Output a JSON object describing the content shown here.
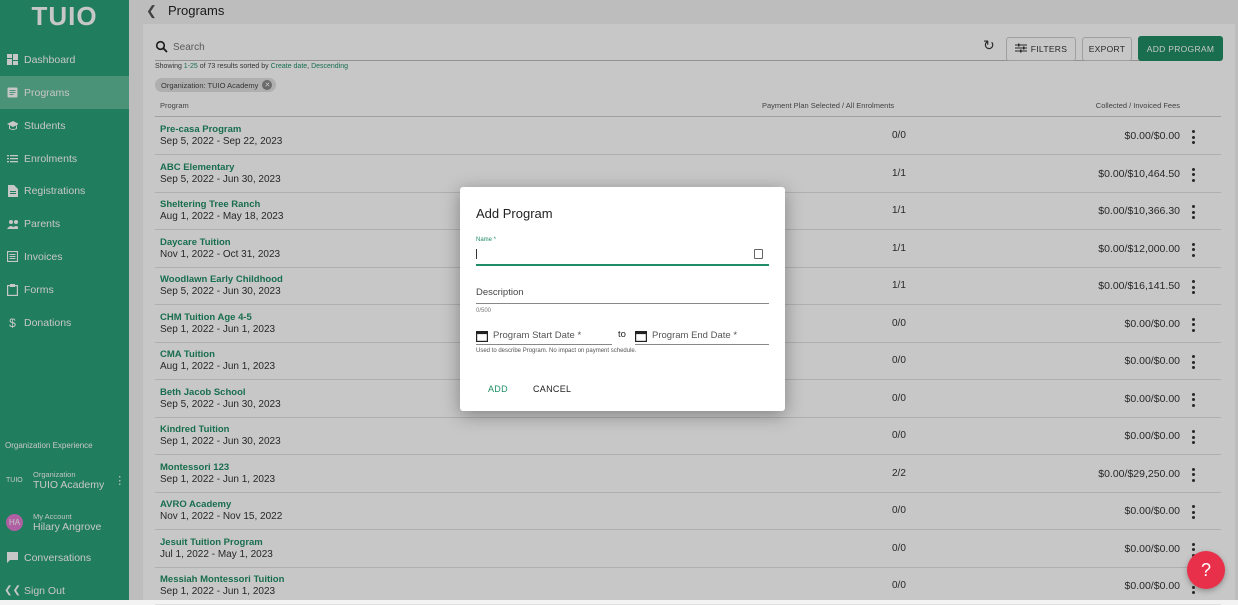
{
  "app": {
    "logo": "TUIO"
  },
  "sidebar": {
    "items": [
      {
        "label": "Dashboard",
        "icon": "dashboard-icon"
      },
      {
        "label": "Programs",
        "icon": "document-icon",
        "active": true
      },
      {
        "label": "Students",
        "icon": "graduation-cap-icon"
      },
      {
        "label": "Enrolments",
        "icon": "list-icon"
      },
      {
        "label": "Registrations",
        "icon": "file-icon"
      },
      {
        "label": "Parents",
        "icon": "people-icon"
      },
      {
        "label": "Invoices",
        "icon": "invoice-icon"
      },
      {
        "label": "Forms",
        "icon": "clipboard-icon"
      },
      {
        "label": "Donations",
        "icon": "dollar-icon"
      }
    ],
    "org_section_label": "Organization Experience",
    "organization": {
      "caption": "Organization",
      "name": "TUIO Academy",
      "logo": "TUIO"
    },
    "account": {
      "caption": "My Account",
      "name": "Hilary Angrove",
      "initials": "HA"
    },
    "conversations": "Conversations",
    "sign_out": "Sign Out"
  },
  "header": {
    "title": "Programs"
  },
  "toolbar": {
    "search_placeholder": "Search",
    "filters": "FILTERS",
    "export": "EXPORT",
    "add_program": "ADD PROGRAM"
  },
  "summary": {
    "prefix": "Showing ",
    "range": "1-25",
    "mid": " of 73 results sorted by ",
    "sort_field": "Create date",
    "sep": ", ",
    "sort_dir": "Descending"
  },
  "filter_chip": "Organization: TUIO Academy",
  "table": {
    "headers": {
      "program": "Program",
      "payment": "Payment Plan Selected / All Enrolments",
      "fees": "Collected / Invoiced Fees"
    },
    "rows": [
      {
        "name": "Pre-casa Program",
        "dates": "Sep 5, 2022 - Sep 22, 2023",
        "ratio": "0/0",
        "fees": "$0.00/$0.00"
      },
      {
        "name": "ABC Elementary",
        "dates": "Sep 5, 2022 - Jun 30, 2023",
        "ratio": "1/1",
        "fees": "$0.00/$10,464.50"
      },
      {
        "name": "Sheltering Tree Ranch",
        "dates": "Aug 1, 2022 - May 18, 2023",
        "ratio": "1/1",
        "fees": "$0.00/$10,366.30"
      },
      {
        "name": "Daycare Tuition",
        "dates": "Nov 1, 2022 - Oct 31, 2023",
        "ratio": "1/1",
        "fees": "$0.00/$12,000.00"
      },
      {
        "name": "Woodlawn Early Childhood",
        "dates": "Sep 5, 2022 - Jun 30, 2023",
        "ratio": "1/1",
        "fees": "$0.00/$16,141.50"
      },
      {
        "name": "CHM Tuition Age 4-5",
        "dates": "Sep 1, 2022 - Jun 1, 2023",
        "ratio": "0/0",
        "fees": "$0.00/$0.00"
      },
      {
        "name": "CMA Tuition",
        "dates": "Aug 1, 2022 - Jun 1, 2023",
        "ratio": "0/0",
        "fees": "$0.00/$0.00"
      },
      {
        "name": "Beth Jacob School",
        "dates": "Sep 5, 2022 - Jun 30, 2023",
        "ratio": "0/0",
        "fees": "$0.00/$0.00"
      },
      {
        "name": "Kindred Tuition",
        "dates": "Sep 1, 2022 - Jun 30, 2023",
        "ratio": "0/0",
        "fees": "$0.00/$0.00"
      },
      {
        "name": "Montessori 123",
        "dates": "Sep 1, 2022 - Jun 1, 2023",
        "ratio": "2/2",
        "fees": "$0.00/$29,250.00"
      },
      {
        "name": "AVRO Academy",
        "dates": "Nov 1, 2022 - Nov 15, 2022",
        "ratio": "0/0",
        "fees": "$0.00/$0.00"
      },
      {
        "name": "Jesuit Tuition Program",
        "dates": "Jul 1, 2022 - May 1, 2023",
        "ratio": "0/0",
        "fees": "$0.00/$0.00"
      },
      {
        "name": "Messiah Montessori Tuition",
        "dates": "Sep 1, 2022 - Jun 1, 2023",
        "ratio": "0/0",
        "fees": "$0.00/$0.00"
      }
    ]
  },
  "dialog": {
    "title": "Add Program",
    "name_label": "Name *",
    "name_value": "",
    "description_label": "Description",
    "counter": "0/500",
    "start_label": "Program Start Date *",
    "to": "to",
    "end_label": "Program End Date *",
    "helper": "Used to describe Program. No impact on payment schedule.",
    "add": "ADD",
    "cancel": "CANCEL"
  },
  "help_button": "?",
  "colors": {
    "sidebar": "#2aa079",
    "accent": "#1f8d65",
    "help": "#e8304a"
  }
}
